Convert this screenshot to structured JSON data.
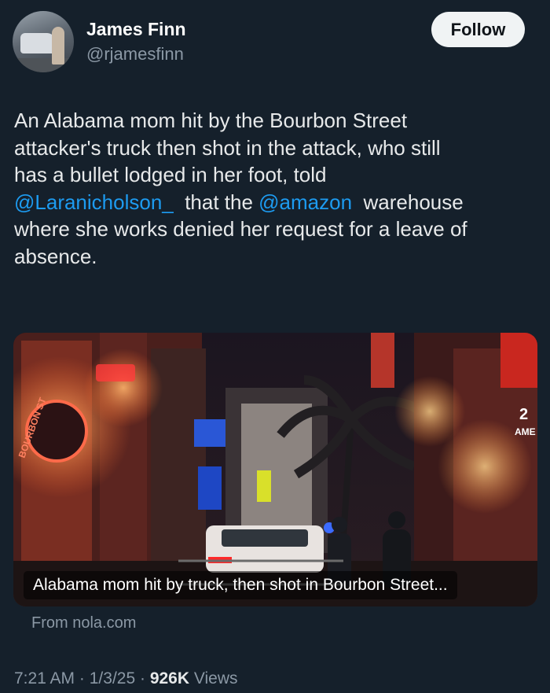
{
  "author": {
    "display_name": "James Finn",
    "handle": "@rjamesfinn",
    "avatar_icon": "avatar-photo"
  },
  "follow_label": "Follow",
  "tweet": {
    "lines": [
      [
        {
          "text": "An Alabama mom hit by the Bourbon Street"
        }
      ],
      [
        {
          "text": "attacker's truck then shot in the attack, who still"
        }
      ],
      [
        {
          "text": "has a bullet lodged in her foot, told"
        }
      ],
      [
        {
          "text": "@Laranicholson_",
          "mention": true
        },
        {
          "text": "  that the "
        },
        {
          "text": "@amazon",
          "mention": true
        },
        {
          "text": "  warehouse"
        }
      ],
      [
        {
          "text": "where she works denied her request for a leave of"
        }
      ],
      [
        {
          "text": "absence."
        }
      ]
    ]
  },
  "card": {
    "title": "Alabama mom hit by truck, then shot in Bourbon Street...",
    "source": "From nola.com",
    "image_signs": [
      "BOURBON ST",
      "2",
      "AME"
    ]
  },
  "meta": {
    "time": "7:21 AM",
    "date": "1/3/25",
    "views_count": "926K",
    "views_label": "Views",
    "separator": "·"
  },
  "colors": {
    "background": "#15202b",
    "text": "#e7e9ea",
    "secondary": "#8b98a5",
    "link": "#1d9bf0"
  }
}
